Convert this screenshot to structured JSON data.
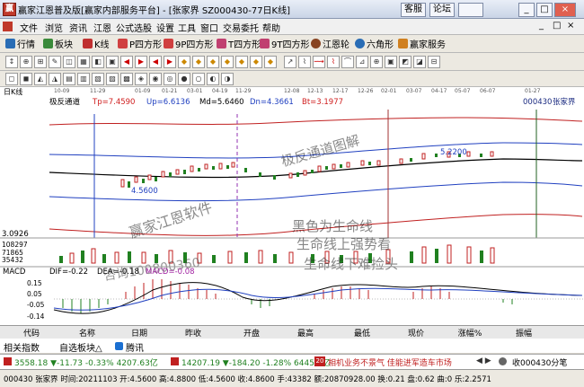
{
  "window": {
    "title": "赢家江恩普及版[赢家内部服务平台] - [张家界 SZ000430-77日K线]",
    "app_badge": "赢",
    "top_buttons": [
      "客服",
      "论坛"
    ],
    "win_buttons": [
      "_",
      "□",
      "×"
    ]
  },
  "menu": {
    "items": [
      "文件",
      "浏览",
      "资讯",
      "江恩",
      "公式选股",
      "设置",
      "工具",
      "窗口",
      "交易委托",
      "帮助"
    ],
    "right_buttons": [
      "_",
      "□",
      "×"
    ]
  },
  "toolbar1": {
    "items": [
      "行情",
      "板块",
      "K线",
      "P四方形",
      "9P四方形",
      "T四方形",
      "9T四方形",
      "江恩轮",
      "六角形",
      "赢家服务"
    ]
  },
  "toolbar3": {
    "left_label": "日K线",
    "dates": [
      "10-09",
      "11-29",
      "01-09",
      "01-21",
      "03-01",
      "04-19",
      "11-29",
      "12-08",
      "12-13",
      "12-17",
      "12-26",
      "02-01",
      "03-07",
      "04-17",
      "05-07",
      "06-07",
      "01-27"
    ]
  },
  "chart_header": {
    "name": "极反通道",
    "tp": "Tp=7.4590",
    "up": "Up=6.6136",
    "md": "Md=5.6460",
    "dn": "Dn=4.3661",
    "bt": "Bt=3.1977",
    "code": "000430",
    "stock": "张家界"
  },
  "annotations": {
    "low_price": "4.5600",
    "high_price": "5.2200",
    "axis_low": "3.0926",
    "vol_1": "108297",
    "vol_2": "71865",
    "vol_3": "35432",
    "wm_1": "赢家江恩软件",
    "wm_2": "极反通道图解",
    "wm_3": "黑色为生命线",
    "wm_4": "生命线上强势看",
    "wm_5": "生命线下难捡头",
    "wm_6": "咨询100800360"
  },
  "macd": {
    "label": "MACD",
    "dif": "DIF=-0.22",
    "dea": "DEA=-0.18",
    "macd": "MACD=-0.08",
    "axis": [
      "0.15",
      "0.05",
      "-0.05",
      "-0.14"
    ]
  },
  "table": {
    "headers": [
      "代码",
      "名称",
      "日期",
      "昨收",
      "开盘",
      "最高",
      "最低",
      "现价",
      "涨幅%",
      "振幅"
    ]
  },
  "tabs": {
    "items": [
      "相关指数",
      "自选板块△",
      "腾讯"
    ]
  },
  "ticker": {
    "sh": "3558.18 ▼-11.73 -0.33% 4207.63亿",
    "sz": "14207.19 ▼-184.20 -1.28% 6445.4亿",
    "news": "相机业务不景气 佳能进军造车市场",
    "code_label": "收000430分笔"
  },
  "status": {
    "text": "000430 张家界 时间:20211103 开:4.5600 高:4.8800 低:4.5600 收:4.8600 手:43382 额:20870928.00 换:0.21 盘:0.62 曲:0 乐:2.2571"
  }
}
